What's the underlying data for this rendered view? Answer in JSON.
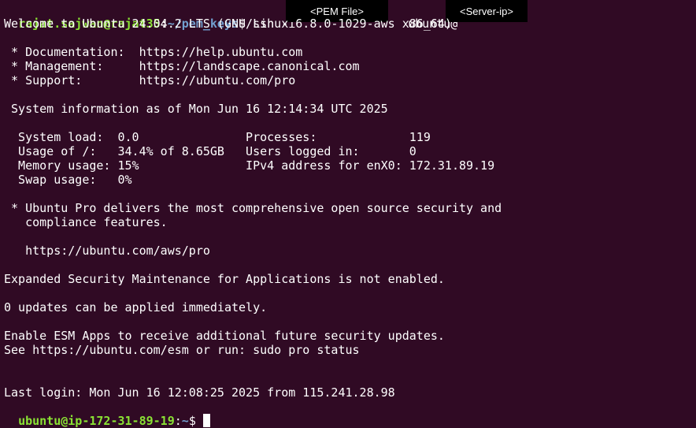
{
  "prompt_command": {
    "user_host": "rajat.sajwan@rajat35",
    "sep": ":",
    "path": "~/pem_keys",
    "symbol": "$",
    "command": " ssh -i ",
    "pem_placeholder": "<PEM File>",
    "remote_user": "ubuntu@",
    "server_placeholder": "<Server-ip>"
  },
  "lines": {
    "welcome": "Welcome to Ubuntu 24.04.2 LTS (GNU/Linux 6.8.0-1029-aws x86_64)",
    "doc": " * Documentation:  https://help.ubuntu.com",
    "mgmt": " * Management:     https://landscape.canonical.com",
    "support": " * Support:        https://ubuntu.com/pro",
    "sysinfo": " System information as of Mon Jun 16 12:14:34 UTC 2025",
    "sysload": "  System load:  0.0               Processes:             119",
    "usage": "  Usage of /:   34.4% of 8.65GB   Users logged in:       0",
    "memory": "  Memory usage: 15%               IPv4 address for enX0: 172.31.89.19",
    "swap": "  Swap usage:   0%",
    "pro1": " * Ubuntu Pro delivers the most comprehensive open source security and",
    "pro2": "   compliance features.",
    "pro_url": "   https://ubuntu.com/aws/pro",
    "esm": "Expanded Security Maintenance for Applications is not enabled.",
    "updates": "0 updates can be applied immediately.",
    "esm_apps": "Enable ESM Apps to receive additional future security updates.",
    "esm_see": "See https://ubuntu.com/esm or run: sudo pro status",
    "last_login": "Last login: Mon Jun 16 12:08:25 2025 from 115.241.28.98"
  },
  "remote_prompt": {
    "user_host": "ubuntu@ip-172-31-89-19",
    "sep": ":",
    "path": "~",
    "symbol": "$ "
  },
  "colors": {
    "background": "#300a24",
    "prompt_user": "#8ae234",
    "prompt_path": "#729fcf",
    "text": "#ffffff"
  }
}
